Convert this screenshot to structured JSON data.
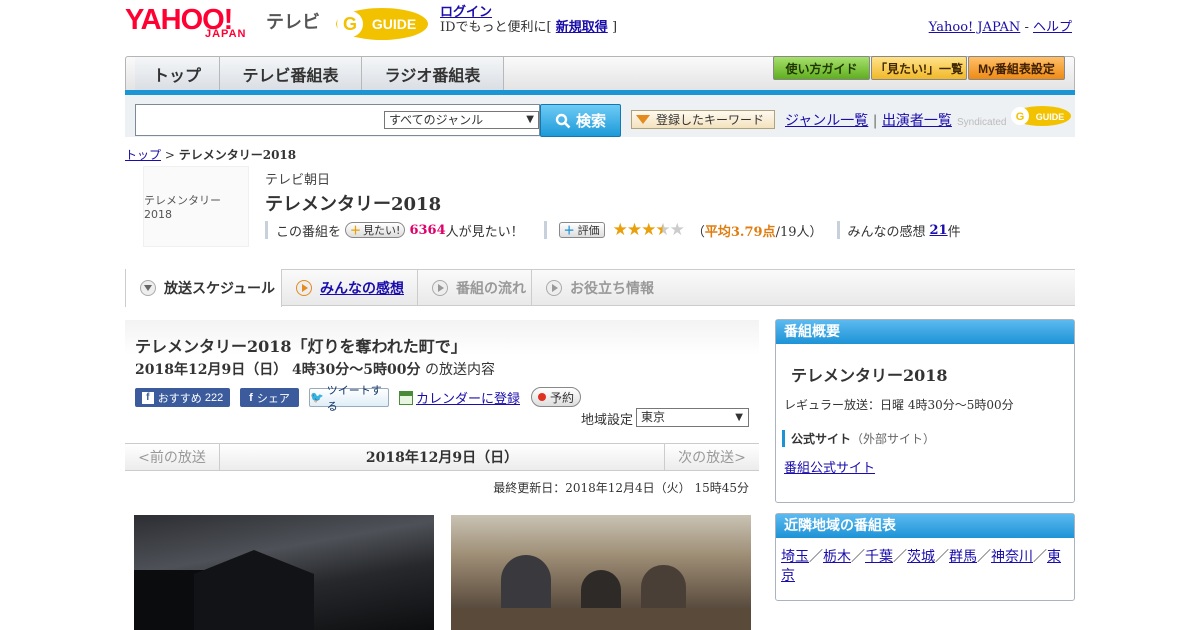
{
  "header": {
    "logo_text": "YAHOO!",
    "logo_sub": "JAPAN",
    "service": "テレビ",
    "gguide": "GUIDE",
    "login_link": "ログイン",
    "id_text": "IDでもっと便利に[",
    "register_link": "新規取得",
    "id_close": "]",
    "yahoo_link": "Yahoo! JAPAN",
    "sep": "-",
    "help_link": "ヘルプ"
  },
  "nav": {
    "tabs": [
      "トップ",
      "テレビ番組表",
      "ラジオ番組表"
    ],
    "guide_buttons": [
      "使い方ガイド",
      "「見たい!」一覧",
      "My番組表設定"
    ]
  },
  "search": {
    "genre_select": "すべてのジャンル",
    "button": "検索",
    "keyword_button": "登録したキーワード",
    "genre_link": "ジャンル一覧",
    "performer_link": "出演者一覧",
    "syndicated": "Syndicated"
  },
  "breadcrumb": {
    "top": "トップ",
    "sep": ">",
    "current": "テレメンタリー2018"
  },
  "program": {
    "thumb_text": "テレメンタリー2018",
    "station": "テレビ朝日",
    "title": "テレメンタリー2018",
    "want_prefix": "この番組を",
    "want_button": "見たい!",
    "want_count": "6364",
    "want_suffix": "人が見たい！",
    "rate_button": "評価",
    "rating_value": 3.79,
    "rating_max": 5,
    "rating_open": "（",
    "rating_label": "平均3.79点",
    "rating_count": "/19人）",
    "impressions_label": "みんなの感想",
    "impressions_count": "21",
    "impressions_unit": "件"
  },
  "subtabs": [
    "放送スケジュール",
    "みんなの感想",
    "番組の流れ",
    "お役立ち情報"
  ],
  "episode": {
    "title": "テレメンタリー2018「灯りを奪われた町で」",
    "datetime": "2018年12月9日（日）  4時30分～5時00分",
    "datetime_suffix": "の放送内容",
    "recommend": "おすすめ",
    "recommend_count": "222",
    "share": "シェア",
    "tweet": "ツイートする",
    "calendar": "カレンダーに登録",
    "reserve": "予約",
    "region_label": "地域設定",
    "region_value": "東京",
    "prev": "<前の放送",
    "current_date": "2018年12月9日（日）",
    "next": "次の放送>",
    "updated": "最終更新日：2018年12月4日（火）  15時45分"
  },
  "sidebar": {
    "overview_title": "番組概要",
    "overview_name": "テレメンタリー2018",
    "regular": "レギュラー放送：日曜 4時30分～5時00分",
    "official_label": "公式サイト",
    "official_note": "（外部サイト）",
    "official_link": "番組公式サイト",
    "nearby_title": "近隣地域の番組表",
    "regions": [
      "埼玉",
      "栃木",
      "千葉",
      "茨城",
      "群馬",
      "神奈川",
      "東京"
    ]
  },
  "colors": {
    "accent": "#1d93d6",
    "brand_red": "#ff0033",
    "pink": "#e0006a",
    "star": "#e9a00a"
  }
}
